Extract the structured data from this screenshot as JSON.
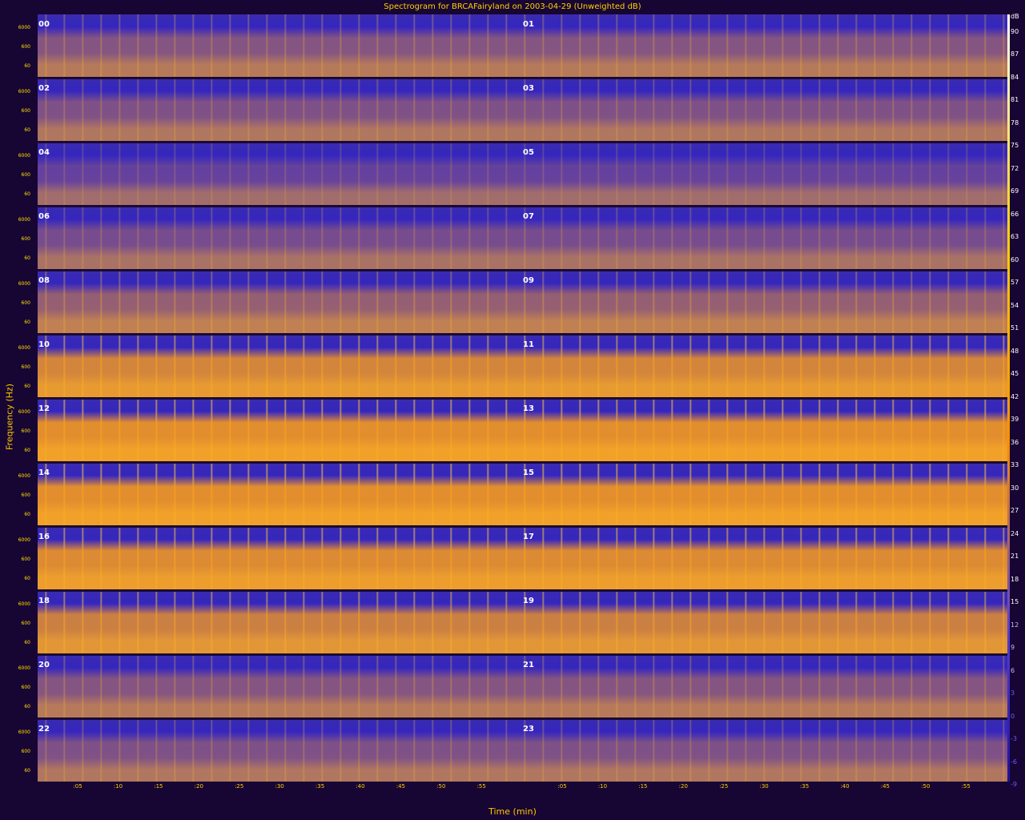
{
  "title": "Spectrogram for BRCAFairyland on 2003-04-29 (Unweighted dB)",
  "chart_data": {
    "type": "heatmap",
    "title": "Spectrogram for BRCAFairyland on 2003-04-29 (Unweighted dB)",
    "xlabel": "Time (min)",
    "ylabel": "Frequency (Hz)",
    "x_ticks": [
      ":05",
      ":10",
      ":15",
      ":20",
      ":25",
      ":30",
      ":35",
      ":40",
      ":45",
      ":50",
      ":55"
    ],
    "y_ticks": [
      "6000",
      "600",
      "60"
    ],
    "hours": [
      "00",
      "01",
      "02",
      "03",
      "04",
      "05",
      "06",
      "07",
      "08",
      "09",
      "10",
      "11",
      "12",
      "13",
      "14",
      "15",
      "16",
      "17",
      "18",
      "19",
      "20",
      "21",
      "22",
      "23"
    ],
    "colorbar_unit": "dB",
    "colorbar_ticks": [
      "90",
      "87",
      "84",
      "81",
      "78",
      "75",
      "72",
      "69",
      "66",
      "63",
      "60",
      "57",
      "54",
      "51",
      "48",
      "45",
      "42",
      "39",
      "36",
      "33",
      "30",
      "27",
      "24",
      "21",
      "18",
      "15",
      "12",
      "9",
      "6",
      "3",
      "0",
      "-3",
      "-6",
      "-9"
    ],
    "colors": {
      "low": "#2a1fd0",
      "mid": "#ff9d00",
      "high": "#ffffff",
      "background": "#170533"
    }
  }
}
